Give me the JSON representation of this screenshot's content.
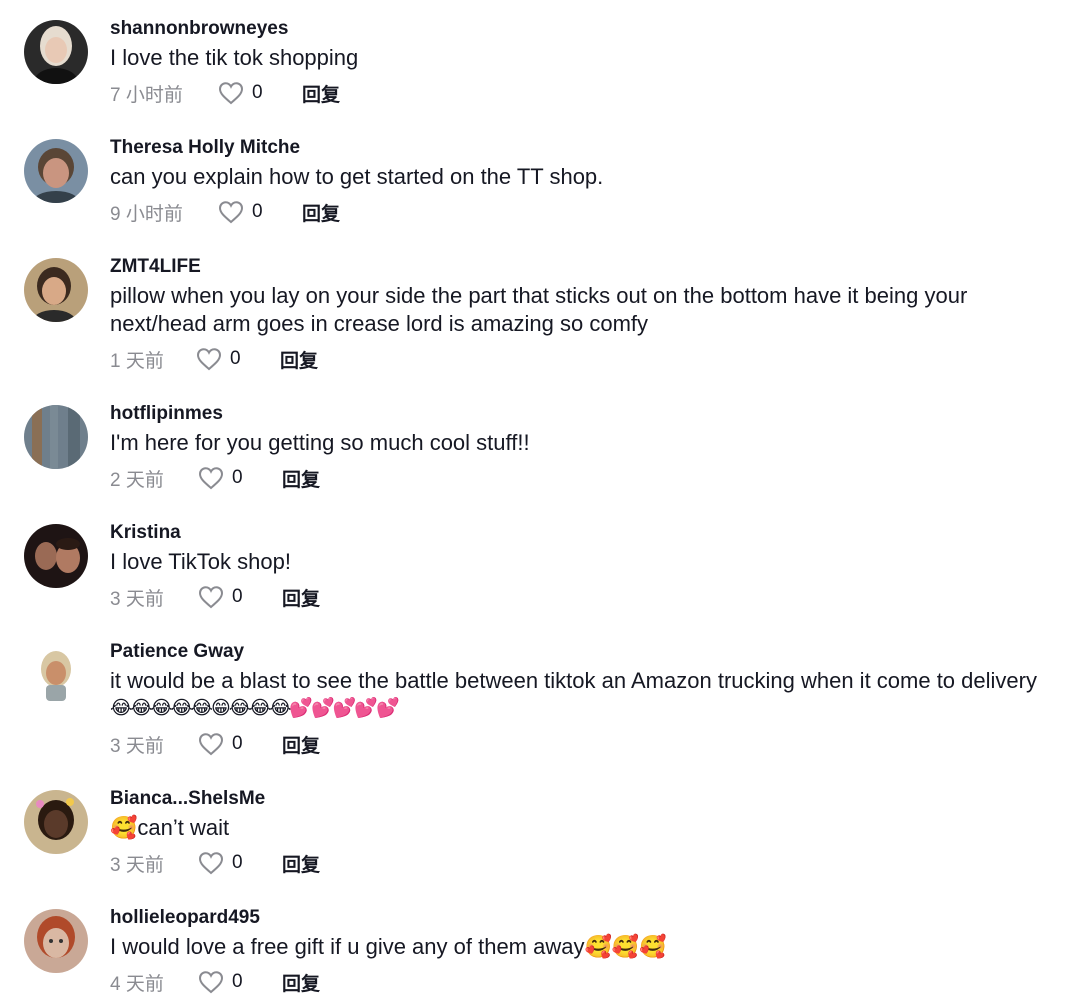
{
  "comments": [
    {
      "username": "shannonbrowneyes",
      "text": "I love the tik tok shopping",
      "time": "7 小时前",
      "likes": "0",
      "reply": "回复",
      "avatar": {
        "bg": "#2a2a2a",
        "skin": "#e8c9b5",
        "hair": "#e6dccf"
      }
    },
    {
      "username": "Theresa Holly Mitche",
      "text": "can you explain how to get started on the TT shop.",
      "time": "9 小时前",
      "likes": "0",
      "reply": "回复",
      "avatar": {
        "bg": "#7a8fa3",
        "skin": "#c99580",
        "hair": "#5a4636"
      }
    },
    {
      "username": "ZMT4LIFE",
      "text": "pillow when you lay on your side the part that sticks out on the bottom have it being your",
      "text2": "next/head arm goes in crease lord is amazing so comfy",
      "time": "1 天前",
      "likes": "0",
      "reply": "回复",
      "avatar": {
        "bg": "#b9a07a",
        "skin": "#d8a987",
        "hair": "#3b2a1f"
      }
    },
    {
      "username": "hotflipinmes",
      "text": "I'm here for you getting so much cool stuff!!",
      "time": "2 天前",
      "likes": "0",
      "reply": "回复",
      "avatar": {
        "bg": "#6f7f8c",
        "skin": "#8a8f93",
        "hair": "#8a6f55"
      }
    },
    {
      "username": "Kristina",
      "text": "I love TikTok shop!",
      "time": "3 天前",
      "likes": "0",
      "reply": "回复",
      "avatar": {
        "bg": "#1e1414",
        "skin": "#9a6a55",
        "hair": "#2a1a14"
      }
    },
    {
      "username": "Patience Gway",
      "text": "it would be a blast to see the battle between tiktok an Amazon trucking when it come to delivery",
      "text2": "😂😂😂😂😂😁😂😂😂💕💕💕💕💕",
      "time": "3 天前",
      "likes": "0",
      "reply": "回复",
      "avatar": {
        "bg": "#ffffff",
        "skin": "#c98f6a",
        "hair": "#d8c7a3"
      }
    },
    {
      "username": "Bianca...ShelsMe",
      "text": "🥰can’t wait",
      "time": "3 天前",
      "likes": "0",
      "reply": "回复",
      "avatar": {
        "bg": "#c9b58f",
        "skin": "#5a3a2a",
        "hair": "#2a1a10"
      }
    },
    {
      "username": "hollieleopard495",
      "text": "I would love a free gift if u give any of them away🥰🥰🥰",
      "time": "4 天前",
      "likes": "0",
      "reply": "回复",
      "avatar": {
        "bg": "#c9a896",
        "skin": "#d9b8a3",
        "hair": "#b04a2a"
      }
    }
  ]
}
